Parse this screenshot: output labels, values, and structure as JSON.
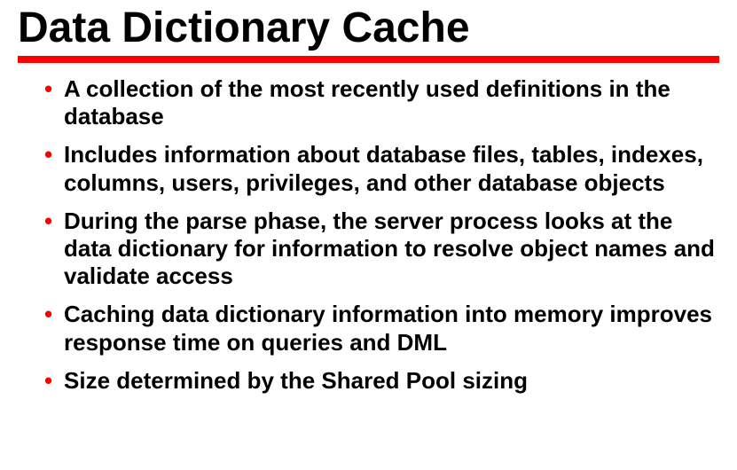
{
  "title": "Data Dictionary Cache",
  "bullets": [
    "A collection of the most recently used definitions in the database",
    "Includes information about database files, tables, indexes, columns, users, privileges, and other database objects",
    "During the parse phase, the server process looks at the data dictionary for information to resolve object names and validate access",
    "Caching data dictionary information into memory improves response time on queries and DML",
    "Size determined by the Shared Pool sizing"
  ]
}
